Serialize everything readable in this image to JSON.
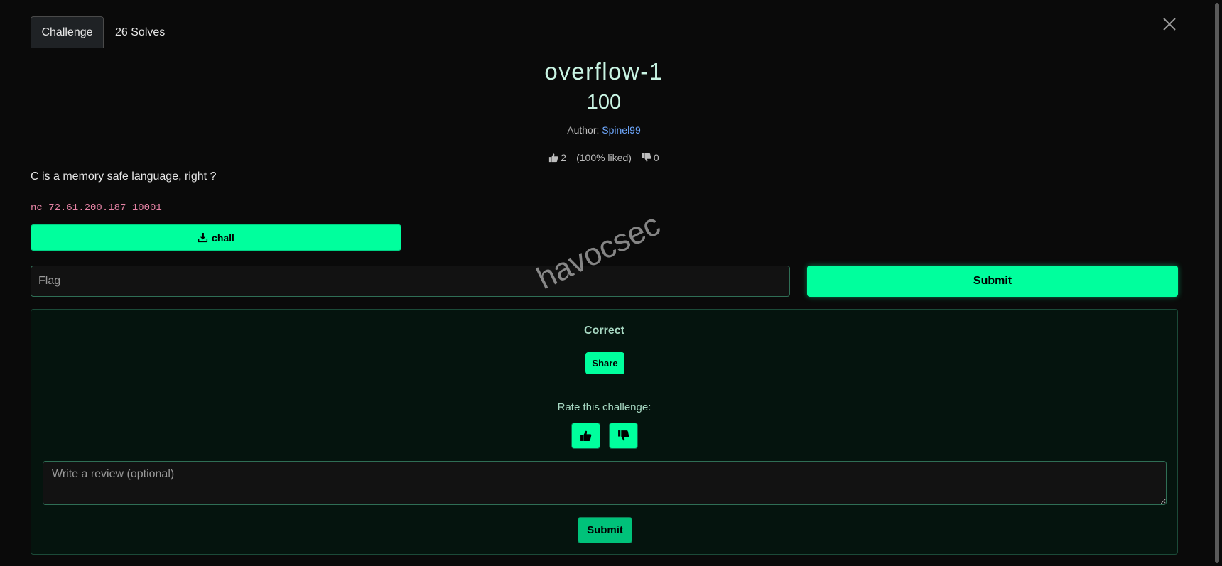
{
  "tabs": [
    {
      "label": "Challenge",
      "active": true
    },
    {
      "label": "26 Solves",
      "active": false
    }
  ],
  "challenge": {
    "name": "overflow-1",
    "value": "100",
    "author_label": "Author:",
    "author_name": "Spinel99",
    "likes": "2",
    "liked_pct": "(100% liked)",
    "dislikes": "0",
    "description": "C is a memory safe language, right ?",
    "connection": "nc 72.61.200.187 10001",
    "file_label": "chall"
  },
  "flag_form": {
    "placeholder": "Flag",
    "submit_label": "Submit"
  },
  "result": {
    "status": "Correct",
    "share_label": "Share",
    "rate_label": "Rate this challenge:",
    "review_placeholder": "Write a review (optional)",
    "review_submit_label": "Submit"
  },
  "watermark": "havocsec",
  "colors": {
    "accent": "#00ff9d",
    "background": "#0a0a0a",
    "title": "#c9f4e3",
    "link": "#6ea8fe",
    "connection_text": "#e683a5"
  },
  "icons": {
    "close": "close-icon",
    "download": "download-icon",
    "thumbs_up": "thumbs-up-icon",
    "thumbs_down": "thumbs-down-icon"
  }
}
